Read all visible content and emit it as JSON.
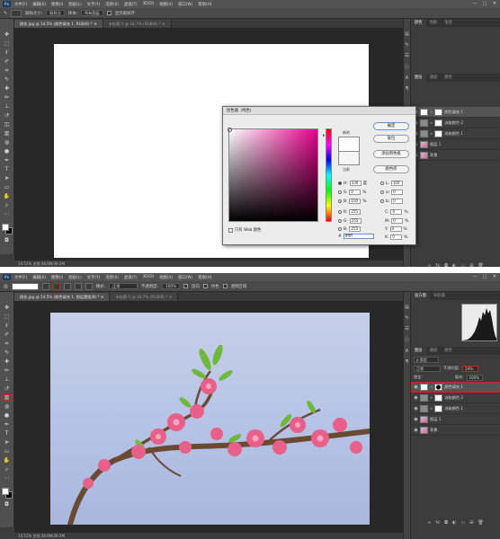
{
  "shot1": {
    "menu": [
      "文件(F)",
      "编辑(E)",
      "图像(I)",
      "图层(L)",
      "文字(Y)",
      "选择(S)",
      "滤镜(T)",
      "3D(D)",
      "视图(V)",
      "窗口(W)",
      "帮助(H)"
    ],
    "window_controls": [
      "—",
      "□",
      "✕"
    ],
    "options": {
      "sample_size_label": "取样大小:",
      "sample_size_value": "取样点",
      "sample_label": "样本:",
      "sample_value": "所有图层",
      "show_ring_label": "显示取样环"
    },
    "tabs": [
      {
        "label": "桃花.jpg @ 14.5% (颜色填充 1, RGB/8) *  ✕",
        "active": true
      },
      {
        "label": "未标题-1 @ 16.7% (RGB/8) *  ✕",
        "active": false
      }
    ],
    "status": "14.51%     文档:28.6M/39.2M",
    "panel_tabs": [
      "颜色",
      "色板",
      "渐变"
    ],
    "layer_tabs": [
      "图层",
      "通道",
      "路径"
    ],
    "layers": [
      {
        "name": "颜色填充 1",
        "type": "fill",
        "selected": true
      },
      {
        "name": "选取颜色 2",
        "type": "adjust",
        "selected": false
      },
      {
        "name": "选取颜色 1",
        "type": "adjust",
        "selected": false
      },
      {
        "name": "图层 1",
        "type": "photo",
        "selected": false
      },
      {
        "name": "背景",
        "type": "photo",
        "selected": false
      }
    ],
    "picker": {
      "title": "拾色器（纯色）",
      "new_label": "新的",
      "current_label": "当前",
      "ok": "确定",
      "cancel": "复位",
      "add_swatch": "添加到色板",
      "libraries": "颜色库",
      "web_only": "只有 Web 颜色",
      "fields": {
        "H": "330",
        "H_unit": "度",
        "S": "0",
        "S_unit": "%",
        "B": "100",
        "B_unit": "%",
        "R": "255",
        "G": "255",
        "Bv": "255",
        "L": "100",
        "a": "0",
        "b": "0",
        "C": "0",
        "M": "0",
        "Y": "0",
        "K": "0",
        "pct": "%"
      },
      "hex_label": "#",
      "hex": "ffffff"
    }
  },
  "shot2": {
    "menu": [
      "文件(F)",
      "编辑(E)",
      "图像(I)",
      "图层(L)",
      "文字(Y)",
      "选择(S)",
      "滤镜(T)",
      "3D(D)",
      "视图(V)",
      "窗口(W)",
      "帮助(H)"
    ],
    "window_controls": [
      "—",
      "□",
      "✕"
    ],
    "options": {
      "mode_label": "模式:",
      "mode_value": "正常",
      "opacity_label": "不透明度:",
      "opacity_value": "100%",
      "reverse_label": "反向",
      "dither_label": "仿色",
      "transparency_label": "透明区域"
    },
    "tabs": [
      {
        "label": "桃花.jpg @ 14.5% (颜色填充 1, 图层蒙版/8) *  ✕",
        "active": true
      },
      {
        "label": "未标题-1 @ 16.7% (RGB/8) *  ✕",
        "active": false
      }
    ],
    "status": "14.51%     文档:28.6M/39.2M",
    "panel_tabs": [
      "直方图",
      "导航器"
    ],
    "layer_tabs": [
      "图层",
      "通道",
      "路径"
    ],
    "kind_label": "ρ 类型",
    "blend_mode": "正常",
    "opacity_label": "不透明度:",
    "opacity_value": "24%",
    "lock_label": "锁定:",
    "fill_label": "填充:",
    "fill_value": "100%",
    "layers": [
      {
        "name": "颜色填充 1",
        "type": "fill",
        "selected": true
      },
      {
        "name": "选取颜色 2",
        "type": "adjust",
        "selected": false
      },
      {
        "name": "选取颜色 1",
        "type": "adjust",
        "selected": false
      },
      {
        "name": "图层 1",
        "type": "photo",
        "selected": false
      },
      {
        "name": "背景",
        "type": "photo",
        "selected": false
      }
    ]
  },
  "colors": {
    "highlight": "#d62020",
    "sky": "#b8c5e6",
    "blossom": "#e8608a",
    "branch": "#6b4a33",
    "leaf": "#6fb83c"
  }
}
